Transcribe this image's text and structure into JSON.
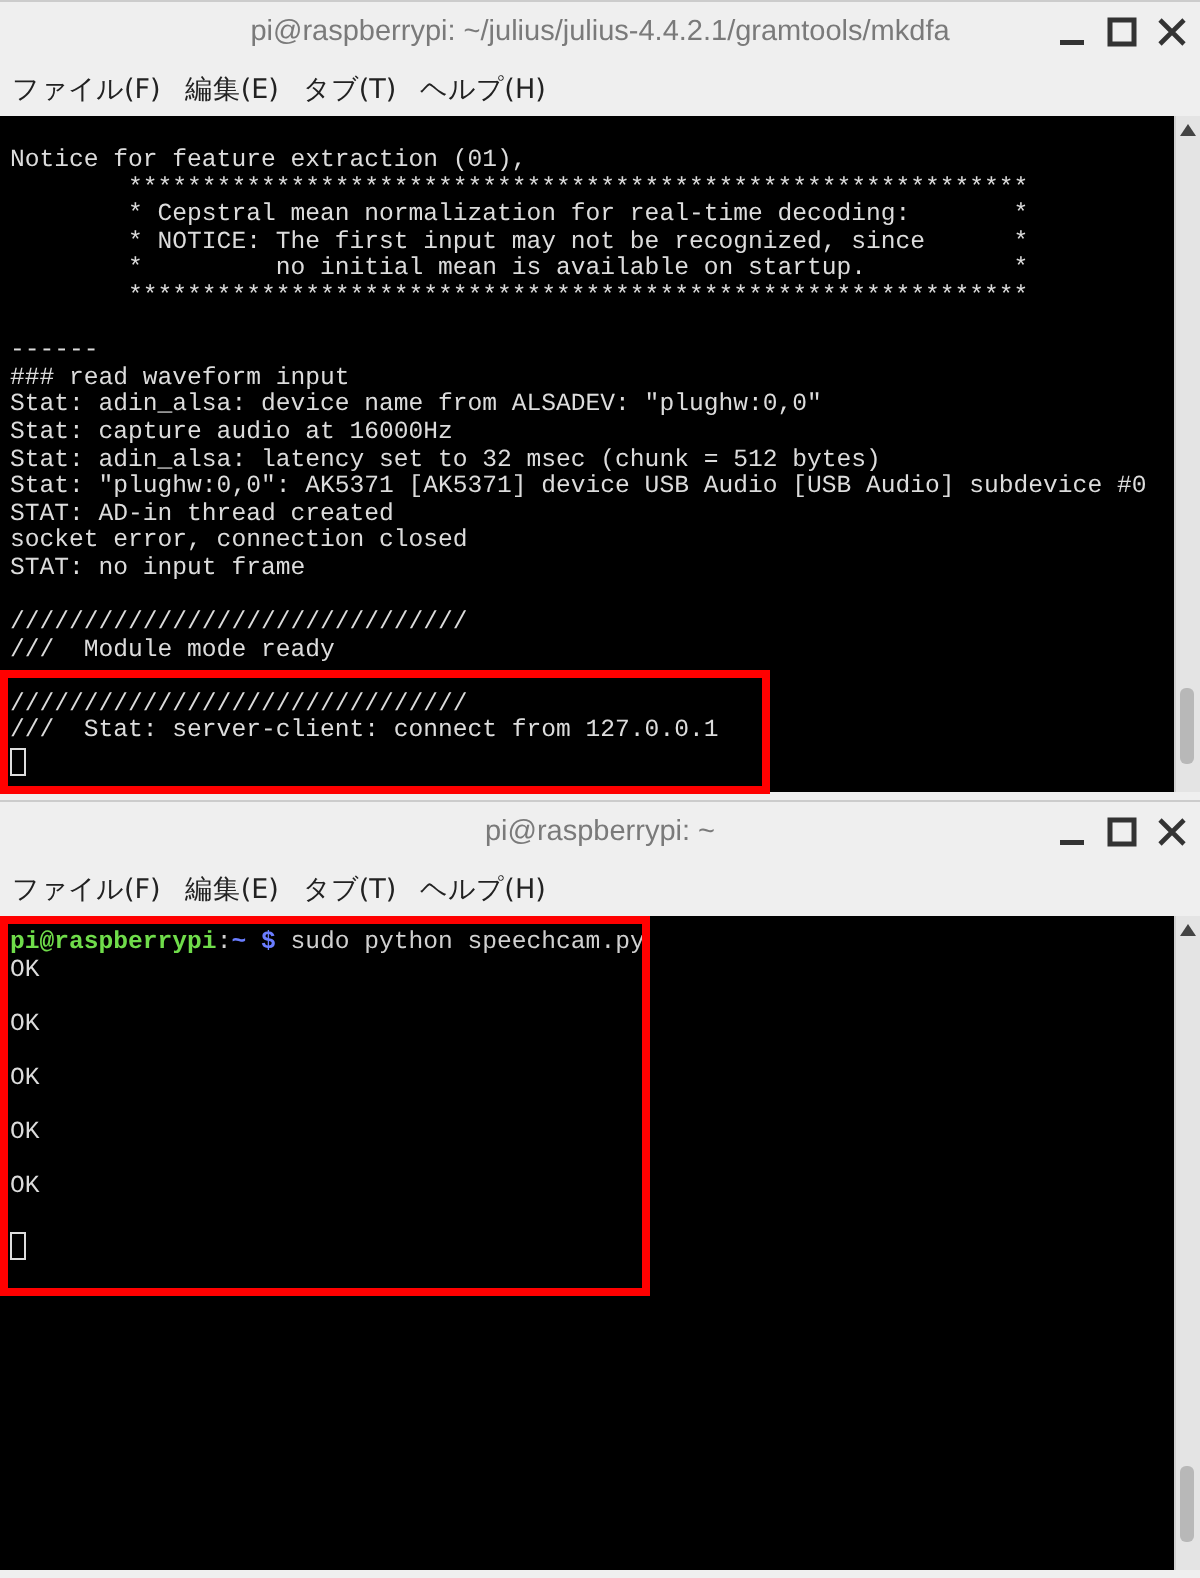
{
  "windows": [
    {
      "title": "pi@raspberrypi: ~/julius/julius-4.4.2.1/gramtools/mkdfa",
      "menu": [
        "ファイル(F)",
        "編集(E)",
        "タブ(T)",
        "ヘルプ(H)"
      ],
      "highlight": true,
      "lines": [
        {
          "kind": "text",
          "text": "Notice for feature extraction (01),"
        },
        {
          "kind": "text",
          "text": "        *************************************************************"
        },
        {
          "kind": "text",
          "text": "        * Cepstral mean normalization for real-time decoding:       *"
        },
        {
          "kind": "text",
          "text": "        * NOTICE: The first input may not be recognized, since      *"
        },
        {
          "kind": "text",
          "text": "        *         no initial mean is available on startup.          *"
        },
        {
          "kind": "text",
          "text": "        *************************************************************"
        },
        {
          "kind": "blank"
        },
        {
          "kind": "text",
          "text": "------"
        },
        {
          "kind": "text",
          "text": "### read waveform input"
        },
        {
          "kind": "text",
          "text": "Stat: adin_alsa: device name from ALSADEV: \"plughw:0,0\""
        },
        {
          "kind": "text",
          "text": "Stat: capture audio at 16000Hz"
        },
        {
          "kind": "text",
          "text": "Stat: adin_alsa: latency set to 32 msec (chunk = 512 bytes)"
        },
        {
          "kind": "text",
          "text": "Stat: \"plughw:0,0\": AK5371 [AK5371] device USB Audio [USB Audio] subdevice #0"
        },
        {
          "kind": "text",
          "text": "STAT: AD-in thread created"
        },
        {
          "kind": "text",
          "text": "socket error, connection closed"
        },
        {
          "kind": "text",
          "text": "STAT: no input frame"
        },
        {
          "kind": "blank"
        },
        {
          "kind": "text",
          "text": "///////////////////////////////"
        },
        {
          "kind": "text",
          "text": "///  Module mode ready"
        },
        {
          "kind": "blank"
        },
        {
          "kind": "text",
          "text": "///////////////////////////////"
        },
        {
          "kind": "text",
          "text": "///  Stat: server-client: connect from 127.0.0.1"
        },
        {
          "kind": "cursor"
        }
      ]
    },
    {
      "title": "pi@raspberrypi: ~",
      "menu": [
        "ファイル(F)",
        "編集(E)",
        "タブ(T)",
        "ヘルプ(H)"
      ],
      "highlight": true,
      "lines": [
        {
          "kind": "prompt",
          "segments": [
            {
              "kind": "user",
              "text": "pi@raspberrypi"
            },
            {
              "kind": "plain",
              "text": ":"
            },
            {
              "kind": "path",
              "text": "~ $"
            },
            {
              "kind": "plain",
              "text": " sudo python speechcam.py"
            }
          ]
        },
        {
          "kind": "text",
          "text": "OK"
        },
        {
          "kind": "blank"
        },
        {
          "kind": "text",
          "text": "OK"
        },
        {
          "kind": "blank"
        },
        {
          "kind": "text",
          "text": "OK"
        },
        {
          "kind": "blank"
        },
        {
          "kind": "text",
          "text": "OK"
        },
        {
          "kind": "blank"
        },
        {
          "kind": "text",
          "text": "OK"
        },
        {
          "kind": "blank"
        },
        {
          "kind": "cursor"
        }
      ]
    }
  ]
}
